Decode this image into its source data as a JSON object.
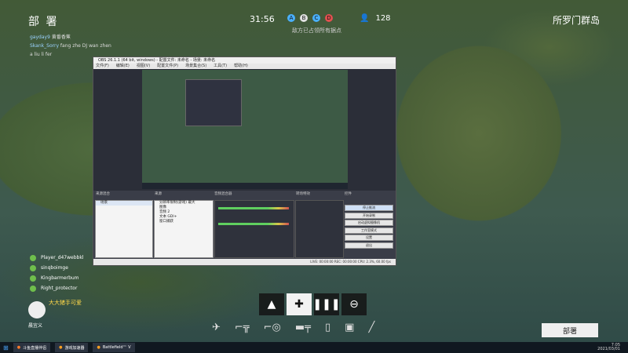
{
  "hud": {
    "title": "部 署",
    "timer": "31:56",
    "objectives": [
      {
        "letter": "A",
        "color": "#4ab0ff"
      },
      {
        "letter": "B",
        "color": "#e2e2e2"
      },
      {
        "letter": "C",
        "color": "#4ab0ff"
      },
      {
        "letter": "D",
        "color": "#e25050"
      }
    ],
    "objective_hint": "敌方已占领所有据点",
    "player_count": "128",
    "map_name": "所罗门群岛"
  },
  "chat": [
    {
      "user": "gayday9",
      "text": "黄番香蕉"
    },
    {
      "user": "Skank_Sorry",
      "text": "fang zhe DJ wan zhen"
    },
    {
      "user": "",
      "text": "a liu li fer"
    }
  ],
  "squad": [
    "Player_d47webbkl",
    "sinqboimge",
    "Kingbarmerbum",
    "Right_protector"
  ],
  "obs": {
    "title": "OBS 26.1.1 (64 bit, windows) - 配置文件: 未命名 - 场景: 未命名",
    "menu": [
      "文件(F)",
      "编辑(E)",
      "视图(V)",
      "配置文件(P)",
      "场景集合(S)",
      "工具(T)",
      "帮助(H)"
    ],
    "dock_headers": [
      "来源混合",
      "来源",
      "音频混合器",
      "转场特效",
      "控件"
    ],
    "scenes": [
      "场景"
    ],
    "sources": [
      "分辨率限制(游戏) 最大",
      "图像",
      "音频 2",
      "文本 GDI+",
      "窗口捕获"
    ],
    "controls": [
      "停止推流",
      "开始录制",
      "启动虚拟摄像机",
      "工作室模式",
      "设置",
      "退出"
    ],
    "status": "LIVE: 00:00:00   REC: 00:00:00   CPU: 2.3%, 60.00 fps"
  },
  "class_bar": [
    {
      "icon": "assault-icon",
      "glyph": "▲"
    },
    {
      "icon": "medic-icon",
      "glyph": "✚"
    },
    {
      "icon": "support-icon",
      "glyph": "❚❚❚"
    },
    {
      "icon": "recon-icon",
      "glyph": "⊖"
    }
  ],
  "weapons": [
    "✈",
    "⌐╦",
    "⌐◎",
    "▬╤",
    "▯",
    "▣",
    "╱"
  ],
  "deploy_label": "部署",
  "streamer": {
    "name": "晨宜义",
    "donor_name": "大大猪手可爱"
  },
  "taskbar": {
    "items": [
      "斗鱼直播伴侣",
      "游戏加速器",
      "Battlefield™ V"
    ],
    "clock_time": "7:05",
    "clock_date": "2021/03/01"
  }
}
